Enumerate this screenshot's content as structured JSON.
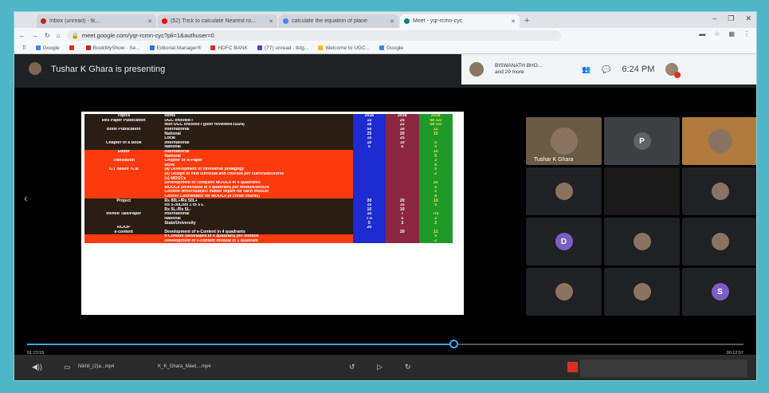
{
  "browser": {
    "tabs": [
      {
        "label": "Inbox (unread) - tk...",
        "fav": "#c5221f"
      },
      {
        "label": "(52) Trick to calculate Nearest ro...",
        "fav": "#ff0000"
      },
      {
        "label": "calculate the equation of plane",
        "fav": "#4285f4"
      },
      {
        "label": "Meet - yqr-rcmn-cyc",
        "fav": "#00897b",
        "active": true
      }
    ],
    "url": "meet.google.com/yqr-rcmn-cyc?pli=1&authuser=0",
    "bookmarks": [
      "Google",
      "",
      "BookMyShow - Se...",
      "Editorial Manager®",
      "HDFC BANK",
      "(77) unread - tktg...",
      "Welcome to UGC...",
      "Google"
    ]
  },
  "meet": {
    "presenting_text": "Tushar K Ghara is presenting",
    "participants_name": "BISWANATH BHO...",
    "participants_more": "and 29 more",
    "time": "6:24 PM",
    "tile_self_label": "Tushar K Ghara",
    "tile_letters": [
      "P",
      "D",
      "S"
    ]
  },
  "slide": {
    "headers": [
      "Topics",
      "Items",
      "2016",
      "2016",
      "2018"
    ],
    "rows": [
      [
        "Res Paper Publication",
        "UGC enlisted I",
        "15",
        "25",
        "08 /10",
        "dk"
      ],
      [
        "",
        "Non UGC enlisted I (peer reviewed-ISSN)",
        "18",
        "22",
        "08 /10",
        "dk"
      ],
      [
        "Book Publication",
        "International",
        "50",
        "30",
        "12",
        "dk"
      ],
      [
        "",
        "National",
        "25",
        "20",
        "10",
        "dk"
      ],
      [
        "",
        "Local",
        "15",
        "25",
        "",
        "dk"
      ],
      [
        "Chapter of a Book",
        "International",
        "10",
        "10",
        "5",
        "dk"
      ],
      [
        "",
        "National",
        "5",
        "5",
        "5",
        "dk"
      ],
      [
        "Editor",
        "International",
        "",
        "",
        "10",
        "rd"
      ],
      [
        "",
        "National",
        "",
        "",
        "5",
        "rd"
      ],
      [
        "Translation",
        "Chapter or R-Paper",
        "",
        "",
        "3",
        "rd"
      ],
      [
        "",
        "Book",
        "",
        "",
        "8",
        "rd"
      ],
      [
        "ICT based TLM",
        "(a) Development of innovative pedagogy",
        "",
        "",
        "5",
        "rd"
      ],
      [
        "",
        "(b) Design of new curricula and courses per curricula/course",
        "",
        "",
        "2",
        "rd"
      ],
      [
        "",
        "(c) MOOCs",
        "",
        "",
        "",
        "rd"
      ],
      [
        "",
        "Development of complete MOOCs in 4 quadrants",
        "",
        "",
        "20",
        "rd"
      ],
      [
        "",
        "MOOCs (developed in 4 quadrant) per module/lecture",
        "",
        "",
        "5",
        "rd"
      ],
      [
        "",
        "Content writer/subject matter expert for each module",
        "",
        "",
        "2",
        "rd"
      ],
      [
        "",
        "Course Coordinator for MOOCs (4 credit course)",
        "",
        "",
        "8",
        "rd"
      ],
      [
        "Project",
        "Rs 80L+/Rs 50L+",
        "20",
        "20",
        "10",
        "dk"
      ],
      [
        "",
        "Rs 5-30L/Rs 1 to 5 L",
        "15",
        "15",
        "5",
        "dk"
      ],
      [
        "",
        "Rs 5L-/Rs 5L-",
        "10",
        "10",
        "",
        "dk"
      ],
      [
        "Invited Talk/Paper",
        "International",
        "10",
        "7",
        "7/5",
        "dk"
      ],
      [
        "",
        "National",
        "7.5",
        "5",
        "3",
        "dk"
      ],
      [
        "",
        "State/University",
        "5",
        "3",
        "2",
        "dk"
      ],
      [
        "RC/OP",
        "",
        "20",
        "",
        "",
        "dk"
      ],
      [
        "e-content",
        "Development of e-Content in 4 quadrants",
        "",
        "20",
        "12",
        "dk"
      ],
      [
        "",
        "e-Content (developed in 4 quadrant) per module",
        "",
        "",
        "5",
        "rd"
      ],
      [
        "",
        "Development of e-content module in 1 quadrant",
        "",
        "",
        "2",
        "rd"
      ]
    ]
  },
  "player": {
    "time_left": "01:23:55",
    "time_right": "00:12:57",
    "left_labels": [
      "Nikhil_(2)a...mp4",
      "K_K_Ghara_Meet....mp4"
    ]
  }
}
